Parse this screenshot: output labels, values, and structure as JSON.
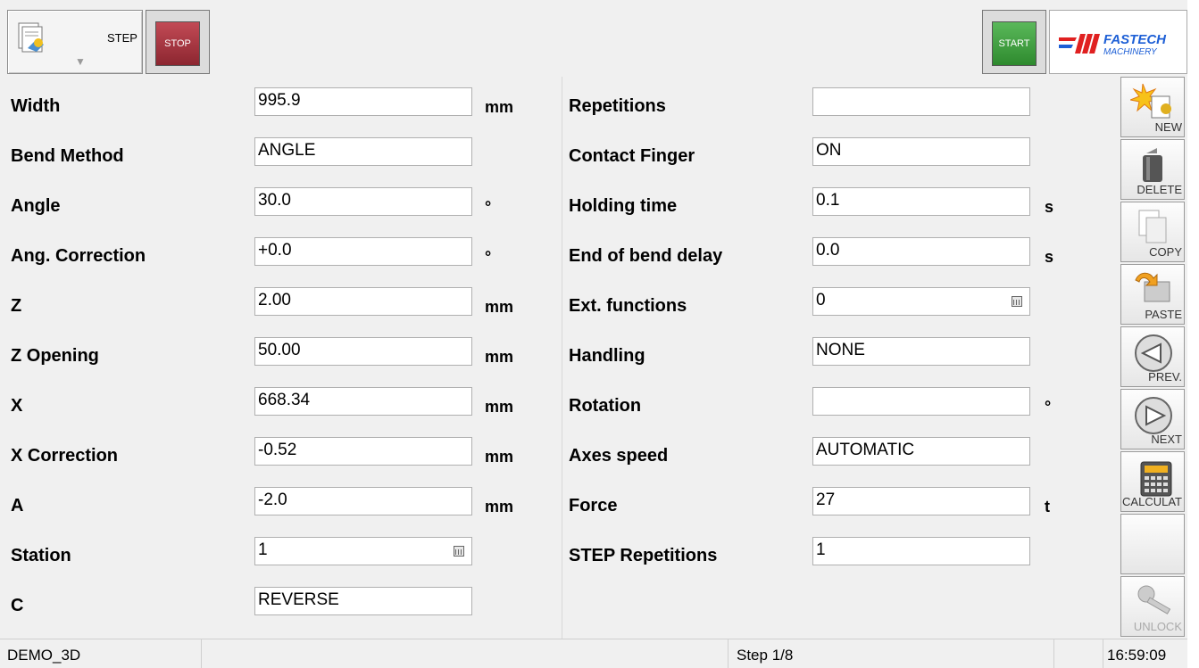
{
  "toolbar": {
    "step_label": "STEP",
    "stop_label": "STOP",
    "start_label": "START",
    "logo_line1": "FASTECH",
    "logo_line2": "MACHINERY"
  },
  "colors": {
    "stop": "#a83440",
    "start": "#3fa03f",
    "logo_blue": "#1d5fd6",
    "logo_red": "#e02020"
  },
  "left_fields": [
    {
      "label": "Width",
      "value": "995.9",
      "unit": "mm"
    },
    {
      "label": "Bend Method",
      "value": "ANGLE",
      "unit": ""
    },
    {
      "label": "Angle",
      "value": "30.0",
      "unit": "°"
    },
    {
      "label": "Ang. Correction",
      "value": "+0.0",
      "unit": "°"
    },
    {
      "label": "Z",
      "value": "2.00",
      "unit": "mm"
    },
    {
      "label": "Z Opening",
      "value": "50.00",
      "unit": "mm"
    },
    {
      "label": "X",
      "value": "668.34",
      "unit": "mm"
    },
    {
      "label": "X Correction",
      "value": "-0.52",
      "unit": "mm"
    },
    {
      "label": "A",
      "value": "-2.0",
      "unit": "mm"
    },
    {
      "label": "Station",
      "value": "1",
      "unit": ""
    },
    {
      "label": "C",
      "value": "REVERSE",
      "unit": ""
    }
  ],
  "right_fields": [
    {
      "label": "Repetitions",
      "value": "",
      "unit": ""
    },
    {
      "label": "Contact Finger",
      "value": "ON",
      "unit": ""
    },
    {
      "label": "Holding time",
      "value": "0.1",
      "unit": "s"
    },
    {
      "label": "End of bend delay",
      "value": "0.0",
      "unit": "s"
    },
    {
      "label": "Ext. functions",
      "value": "0",
      "unit": ""
    },
    {
      "label": "Handling",
      "value": "NONE",
      "unit": ""
    },
    {
      "label": "Rotation",
      "value": "",
      "unit": "°"
    },
    {
      "label": "Axes speed",
      "value": "AUTOMATIC",
      "unit": ""
    },
    {
      "label": "Force",
      "value": "27",
      "unit": "t"
    },
    {
      "label": "STEP Repetitions",
      "value": "1",
      "unit": ""
    }
  ],
  "sidebar": [
    {
      "label": "NEW",
      "icon": "new-icon",
      "enabled": true
    },
    {
      "label": "DELETE",
      "icon": "trash-icon",
      "enabled": true
    },
    {
      "label": "COPY",
      "icon": "copy-icon",
      "enabled": true
    },
    {
      "label": "PASTE",
      "icon": "paste-icon",
      "enabled": true
    },
    {
      "label": "PREV.",
      "icon": "prev-arrow-icon",
      "enabled": true
    },
    {
      "label": "NEXT",
      "icon": "next-arrow-icon",
      "enabled": true
    },
    {
      "label": "CALCULAT",
      "icon": "calculator-icon",
      "enabled": true
    },
    {
      "label": "",
      "icon": "",
      "enabled": true
    },
    {
      "label": "UNLOCK",
      "icon": "key-icon",
      "enabled": false
    }
  ],
  "status": {
    "program": "DEMO_3D",
    "step": "Step 1/8",
    "time": "16:59:09"
  }
}
